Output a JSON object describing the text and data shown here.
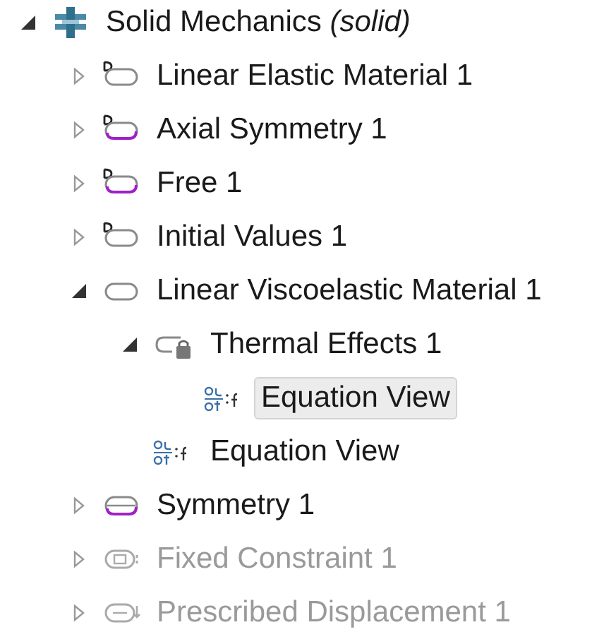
{
  "tree": [
    {
      "label": "Solid Mechanics *(solid)*",
      "kind": "physics",
      "expanded": true,
      "disabled": false,
      "selected": false,
      "children": [
        {
          "label": "Linear Elastic Material 1",
          "kind": "default-domain",
          "expanded": false,
          "disabled": false,
          "selected": false
        },
        {
          "label": "Axial Symmetry 1",
          "kind": "default-boundary",
          "expanded": false,
          "disabled": false,
          "selected": false
        },
        {
          "label": "Free 1",
          "kind": "default-boundary",
          "expanded": false,
          "disabled": false,
          "selected": false
        },
        {
          "label": "Initial Values 1",
          "kind": "default-domain",
          "expanded": false,
          "disabled": false,
          "selected": false
        },
        {
          "label": "Linear Viscoelastic Material 1",
          "kind": "domain",
          "expanded": true,
          "disabled": false,
          "selected": false,
          "children": [
            {
              "label": "Thermal Effects 1",
              "kind": "locked",
              "expanded": true,
              "disabled": false,
              "selected": false,
              "children": [
                {
                  "label": "Equation View",
                  "kind": "equation",
                  "disabled": false,
                  "selected": true
                }
              ]
            },
            {
              "label": "Equation View",
              "kind": "equation",
              "disabled": false,
              "selected": false
            }
          ]
        },
        {
          "label": "Symmetry 1",
          "kind": "boundary",
          "expanded": false,
          "disabled": false,
          "selected": false
        },
        {
          "label": "Fixed Constraint 1",
          "kind": "constraint",
          "expanded": false,
          "disabled": true,
          "selected": false
        },
        {
          "label": "Prescribed Displacement 1",
          "kind": "prescribed",
          "expanded": false,
          "disabled": true,
          "selected": false
        }
      ]
    }
  ]
}
